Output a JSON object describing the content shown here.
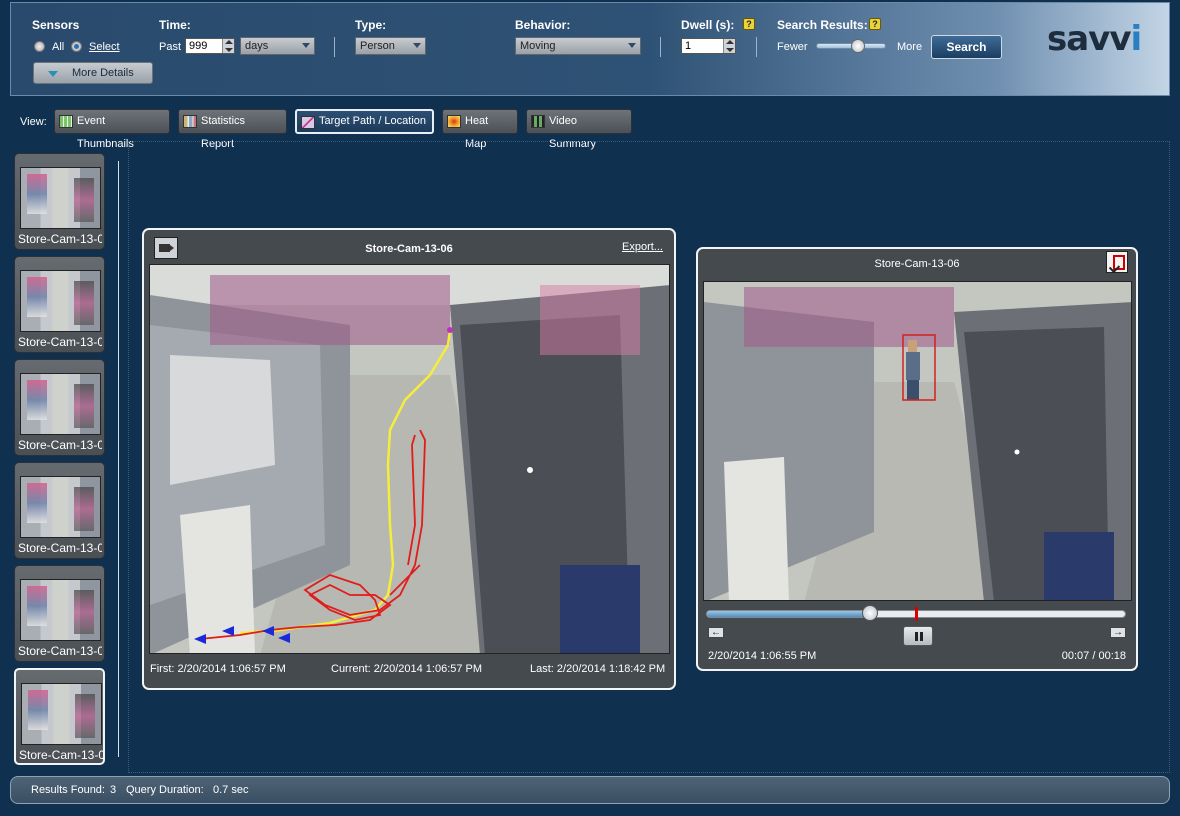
{
  "toolbar": {
    "sensors": {
      "label": "Sensors",
      "opt_all": "All",
      "opt_select": "Select"
    },
    "time": {
      "label": "Time:",
      "past": "Past",
      "value": "999",
      "unit": "days"
    },
    "type": {
      "label": "Type:",
      "value": "Person"
    },
    "behavior": {
      "label": "Behavior:",
      "value": "Moving"
    },
    "dwell": {
      "label": "Dwell (s):",
      "value": "1",
      "help": "?"
    },
    "results": {
      "label": "Search Results:",
      "fewer": "Fewer",
      "more": "More",
      "help": "?",
      "slider_level": 0.6
    },
    "search_label": "Search",
    "more_details": "More Details",
    "logo_a": "savv",
    "logo_b": "i"
  },
  "view": {
    "label": "View:",
    "buttons": [
      {
        "label": "Event Thumbnails",
        "color": "#7cc46a"
      },
      {
        "label": "Statistics Report",
        "color": "#c9b47a"
      },
      {
        "label": "Target Path / Location",
        "color": "#d9c8e8"
      },
      {
        "label": "Heat Map",
        "color": "#f0a22a"
      },
      {
        "label": "Video Summary",
        "color": "#3b6a3b"
      }
    ],
    "active_index": 2
  },
  "thumbnails": [
    {
      "label": "Store-Cam-13-0"
    },
    {
      "label": "Store-Cam-13-0"
    },
    {
      "label": "Store-Cam-13-0"
    },
    {
      "label": "Store-Cam-13-0"
    },
    {
      "label": "Store-Cam-13-0"
    },
    {
      "label": "Store-Cam-13-0"
    }
  ],
  "selected_thumbnail": 5,
  "main_panel": {
    "title": "Store-Cam-13-06",
    "export": "Export...",
    "first": "First:  2/20/2014 1:06:57 PM",
    "current": "Current:  2/20/2014 1:06:57 PM",
    "last": "Last:  2/20/2014 1:18:42 PM"
  },
  "player_panel": {
    "title": "Store-Cam-13-06",
    "timestamp": "2/20/2014 1:06:55 PM",
    "elapsed": "00:07 / 00:18",
    "progress": 0.39,
    "marker": 0.5
  },
  "status": {
    "results_label": "Results Found:",
    "results_value": "3",
    "duration_label": "Query Duration:",
    "duration_value": "0.7 sec"
  },
  "colors": {
    "path_yellow": "#f4ee3a",
    "path_red": "#e21b1b",
    "path_blue": "#1a2ad8"
  }
}
